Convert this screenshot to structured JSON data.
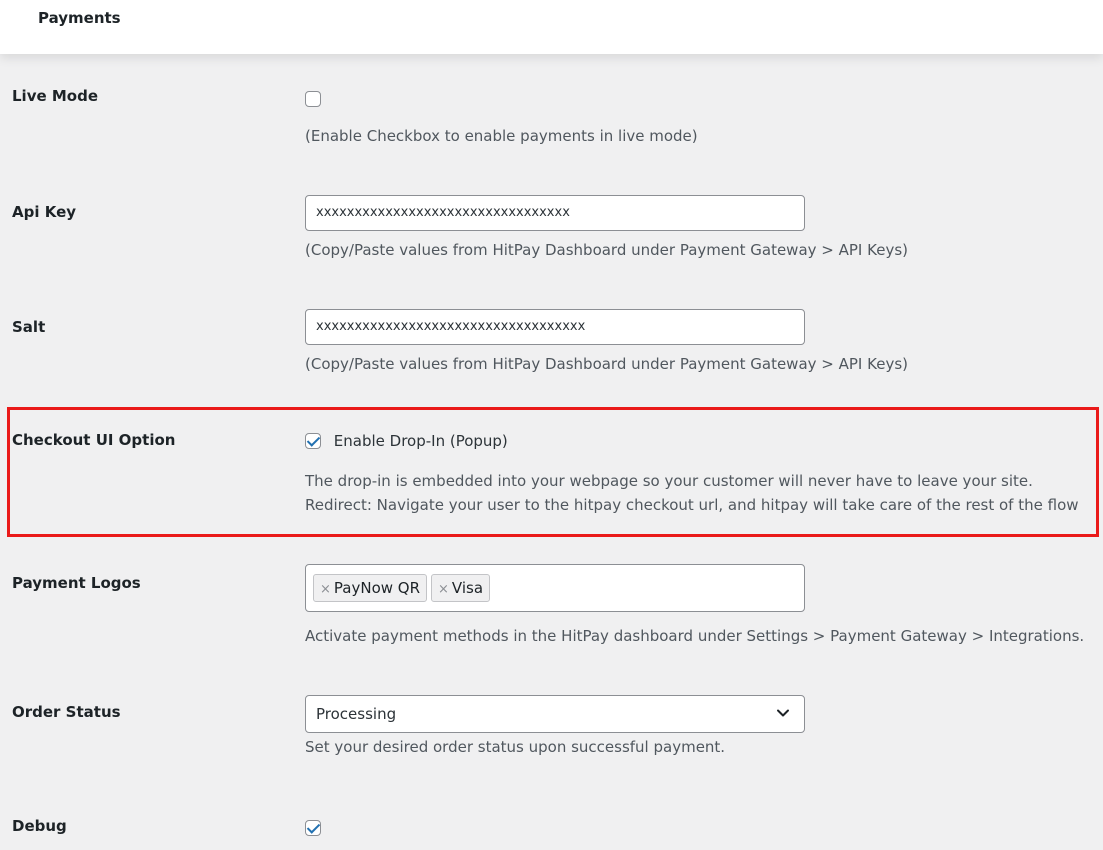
{
  "header": {
    "tab_label": "Payments"
  },
  "settings": {
    "live_mode": {
      "label": "Live Mode",
      "checked": false,
      "description": "(Enable Checkbox to enable payments in live mode)"
    },
    "api_key": {
      "label": "Api Key",
      "value": "xxxxxxxxxxxxxxxxxxxxxxxxxxxxxxxxx",
      "description": "(Copy/Paste values from HitPay Dashboard under Payment Gateway > API Keys)"
    },
    "salt": {
      "label": "Salt",
      "value": "xxxxxxxxxxxxxxxxxxxxxxxxxxxxxxxxxxx",
      "description": "(Copy/Paste values from HitPay Dashboard under Payment Gateway > API Keys)"
    },
    "checkout_ui": {
      "label": "Checkout UI Option",
      "checked": true,
      "checkbox_label": "Enable Drop-In (Popup)",
      "description_1": "The drop-in is embedded into your webpage so your customer will never have to leave your site.",
      "description_2": "Redirect: Navigate your user to the hitpay checkout url, and hitpay will take care of the rest of the flow",
      "highlight_color": "#ea1a1a"
    },
    "payment_logos": {
      "label": "Payment Logos",
      "tags": [
        {
          "remove": "×",
          "label": "PayNow QR"
        },
        {
          "remove": "×",
          "label": "Visa"
        }
      ],
      "description": "Activate payment methods in the HitPay dashboard under Settings > Payment Gateway > Integrations."
    },
    "order_status": {
      "label": "Order Status",
      "selected": "Processing",
      "description": "Set your desired order status upon successful payment."
    },
    "debug": {
      "label": "Debug",
      "checked": true
    }
  },
  "colors": {
    "background": "#f0f0f1",
    "accent": "#2271b1"
  }
}
